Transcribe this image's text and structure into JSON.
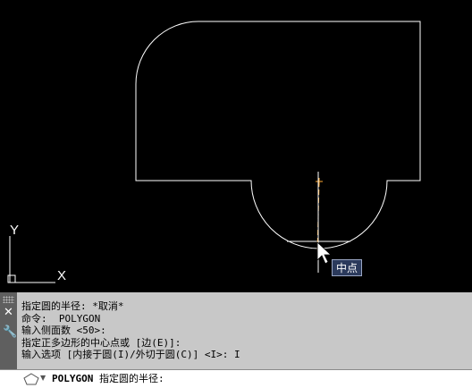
{
  "viewport": {
    "tooltip": "中点",
    "ucs": {
      "x_label": "X",
      "y_label": "Y"
    }
  },
  "command_line": {
    "history": [
      "指定圆的半径: *取消*",
      "命令:  POLYGON",
      "输入侧面数 <50>:",
      "指定正多边形的中心点或 [边(E)]:",
      "输入选项 [内接于圆(I)/外切于圆(C)] <I>: I"
    ],
    "prompt": {
      "command": "POLYGON",
      "text": " 指定圆的半径:"
    },
    "icons": {
      "close": "close-icon",
      "customize": "wrench-icon",
      "prompt": "polygon-command-icon"
    }
  },
  "colors": {
    "background": "#000000",
    "geometry": "#ffffff",
    "cursor_marker": "#ffaa33",
    "command_panel": "#c8c8c8",
    "tooltip_bg": "#2b3a5c"
  }
}
